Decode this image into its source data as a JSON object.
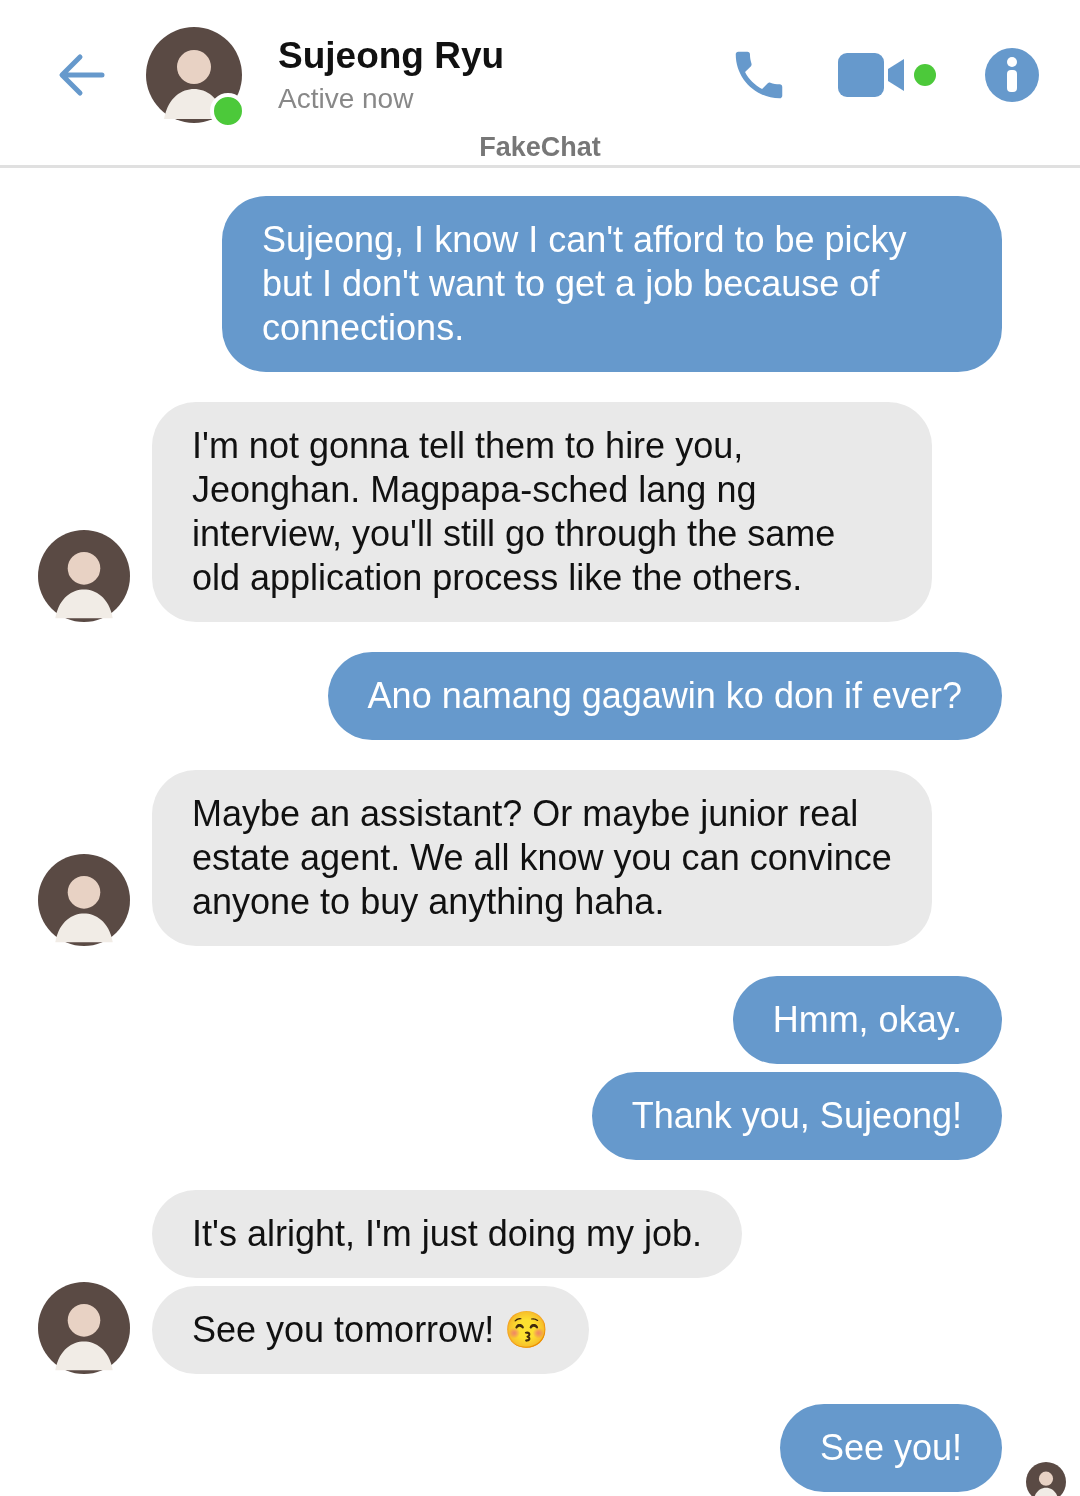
{
  "header": {
    "name": "Sujeong Ryu",
    "status": "Active now",
    "online": true,
    "video_online": true,
    "app_label": "FakeChat"
  },
  "groups": [
    {
      "kind": "sent",
      "messages": [
        "Sujeong, I know I can't afford to be picky but I don't want to get a job because of connections."
      ]
    },
    {
      "kind": "received",
      "messages": [
        "I'm not gonna tell them to hire you, Jeonghan. Magpapa-sched lang ng interview,  you'll still go through the same old application process like the others."
      ]
    },
    {
      "kind": "sent",
      "messages": [
        "Ano namang gagawin ko don if ever?"
      ]
    },
    {
      "kind": "received",
      "messages": [
        "Maybe an assistant? Or maybe junior real estate agent. We all know you can convince anyone to buy anything haha."
      ]
    },
    {
      "kind": "sent",
      "messages": [
        "Hmm, okay.",
        "Thank you, Sujeong!"
      ]
    },
    {
      "kind": "received",
      "messages": [
        "It's alright, I'm just doing my job.",
        "See you tomorrow! 😚"
      ]
    },
    {
      "kind": "sent",
      "seen": true,
      "messages": [
        "See you!"
      ]
    }
  ]
}
